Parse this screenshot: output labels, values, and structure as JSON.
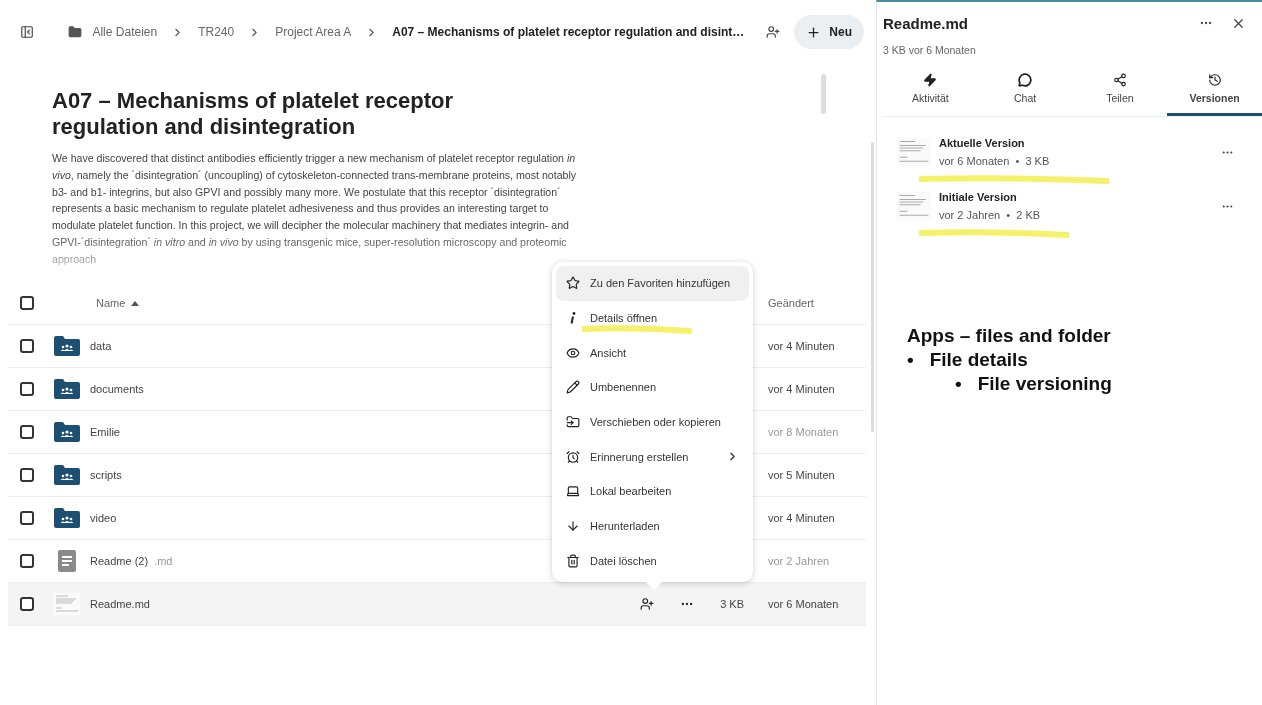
{
  "breadcrumbs": [
    {
      "label": "Alle Dateien",
      "kind": "root",
      "current": false
    },
    {
      "label": "TR240",
      "kind": "folder",
      "current": false
    },
    {
      "label": "Project Area A",
      "kind": "folder",
      "current": false
    },
    {
      "label": "A07 – Mechanisms of platelet receptor regulation and disint…",
      "kind": "folder",
      "current": true
    }
  ],
  "new_button": "Neu",
  "readme": {
    "title": "A07 – Mechanisms of platelet receptor regulation and disintegration",
    "text": "We have discovered that distinct antibodies efficiently trigger a new mechanism of platelet receptor regulation *in vivo*, namely the ´disintegration´ (uncoupling) of cytoskeleton-connected trans-membrane proteins, most notably b3- and b1- integrins, but also GPVI and possibly many more. We postulate that this receptor ´disintegration´ represents a basic mechanism to regulate platelet adhesiveness and thus provides an interesting target to modulate platelet function. In this project, we will decipher the molecular machinery that mediates integrin- and GPVI-´disintegration´ *in vitro* and *in vivo* by using transgenic mice, super-resolution microscopy and proteomic approach"
  },
  "table": {
    "select_all": {
      "checked": false
    },
    "columns": [
      {
        "label": "Name",
        "sorted": true
      },
      {
        "label": "Geändert",
        "sorted": false
      }
    ],
    "rows": [
      {
        "name": "data",
        "kind": "folder",
        "modified": "vor 4 Minuten",
        "recent": true,
        "checked": false,
        "active": false
      },
      {
        "name": "documents",
        "kind": "folder",
        "modified": "vor 4 Minuten",
        "recent": true,
        "checked": false,
        "active": false
      },
      {
        "name": "Emilie",
        "kind": "folder",
        "modified": "vor 8 Monaten",
        "recent": false,
        "checked": false,
        "active": false
      },
      {
        "name": "scripts",
        "kind": "folder",
        "modified": "vor 5 Minuten",
        "recent": true,
        "checked": false,
        "active": false
      },
      {
        "name": "video",
        "kind": "folder",
        "modified": "vor 4 Minuten",
        "recent": true,
        "checked": false,
        "active": false
      },
      {
        "name": "Readme (2)",
        "extension": ".md",
        "kind": "document",
        "modified": "vor 2 Jahren",
        "recent": false,
        "checked": false,
        "active": false
      },
      {
        "name": "Readme.md",
        "kind": "preview",
        "size": "3 KB",
        "modified": "vor 6 Monaten",
        "recent": true,
        "checked": false,
        "active": true
      }
    ]
  },
  "context_menu": [
    {
      "label": "Zu den Favoriten hinzufügen",
      "kind": "star",
      "selected": true,
      "submenu": false,
      "highlighted": false
    },
    {
      "label": "Details öffnen",
      "kind": "info",
      "selected": false,
      "submenu": false,
      "highlighted": true
    },
    {
      "label": "Ansicht",
      "kind": "eye",
      "selected": false,
      "submenu": false,
      "highlighted": false
    },
    {
      "label": "Umbenennen",
      "kind": "pencil",
      "selected": false,
      "submenu": false,
      "highlighted": false
    },
    {
      "label": "Verschieben oder kopieren",
      "kind": "move",
      "selected": false,
      "submenu": false,
      "highlighted": false
    },
    {
      "label": "Erinnerung erstellen",
      "kind": "alarm",
      "selected": false,
      "submenu": true,
      "highlighted": false
    },
    {
      "label": "Lokal bearbeiten",
      "kind": "laptop",
      "selected": false,
      "submenu": false,
      "highlighted": false
    },
    {
      "label": "Herunterladen",
      "kind": "download",
      "selected": false,
      "submenu": false,
      "highlighted": false
    },
    {
      "label": "Datei löschen",
      "kind": "trash",
      "selected": false,
      "submenu": false,
      "highlighted": false
    }
  ],
  "sidebar": {
    "title": "Readme.md",
    "subtitle": "3 KB vor 6 Monaten",
    "tabs": [
      {
        "label": "Aktivität",
        "kind": "activity",
        "selected": false
      },
      {
        "label": "Chat",
        "kind": "chat",
        "selected": false
      },
      {
        "label": "Teilen",
        "kind": "share",
        "selected": false
      },
      {
        "label": "Versionen",
        "kind": "versions",
        "selected": true
      }
    ],
    "versions": [
      {
        "title": "Aktuelle Version",
        "meta": "vor 6 Monaten  •  3 KB",
        "highlighted": true
      },
      {
        "title": "Initiale Version",
        "meta": "vor 2 Jahren  •  2 KB",
        "highlighted": true
      }
    ]
  },
  "notes": [
    {
      "text": "Apps – files and folder",
      "children": [
        {
          "bullet": "•",
          "text": "File details",
          "children": [
            {
              "bullet": "•",
              "text": "File versioning"
            }
          ]
        }
      ]
    }
  ]
}
